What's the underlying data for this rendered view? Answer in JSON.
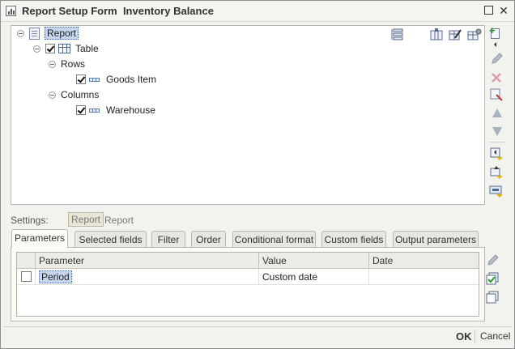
{
  "window": {
    "title": "Report Setup Form  Inventory Balance",
    "close_glyph": "✕"
  },
  "tree": {
    "nodes": [
      {
        "label": "Report",
        "icon": "report-document-icon",
        "selected": true
      },
      {
        "label": "Table",
        "icon": "table-icon",
        "checked": true
      },
      {
        "label": "Rows"
      },
      {
        "label": "Goods Item",
        "icon": "field-icon",
        "checked": true
      },
      {
        "label": "Columns"
      },
      {
        "label": "Warehouse",
        "icon": "field-icon",
        "checked": true
      }
    ]
  },
  "settings": {
    "label": "Settings:",
    "chip": "Report",
    "link": "Report"
  },
  "tabs": [
    {
      "label": "Parameters",
      "active": true
    },
    {
      "label": "Selected fields"
    },
    {
      "label": "Filter"
    },
    {
      "label": "Order"
    },
    {
      "label": "Conditional format"
    },
    {
      "label": "Custom fields"
    },
    {
      "label": "Output parameters"
    }
  ],
  "params_grid": {
    "columns": [
      "Parameter",
      "Value",
      "Date"
    ],
    "rows": [
      {
        "checked": false,
        "parameter": "Period",
        "value": "Custom date",
        "date": ""
      }
    ]
  },
  "footer": {
    "ok": "OK",
    "cancel": "Cancel"
  },
  "colors": {
    "accent_green": "#2a9a2a",
    "delete_red": "#cc4444",
    "selection": "#c6d6ee"
  }
}
